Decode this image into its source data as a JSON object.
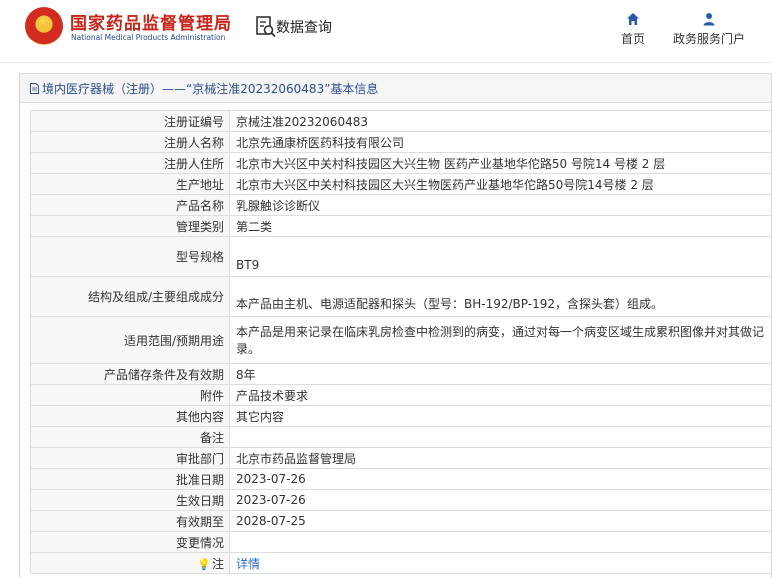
{
  "header": {
    "title_cn": "国家药品监督管理局",
    "title_en": "National Medical Products Administration",
    "search_label": "数据查询",
    "nav": [
      {
        "label": "首页",
        "icon": "home-icon"
      },
      {
        "label": "政务服务门户",
        "icon": "user-icon"
      }
    ]
  },
  "panel": {
    "title": "境内医疗器械（注册）——“京械注准20232060483”基本信息"
  },
  "rows": [
    {
      "label": "注册证编号",
      "value": "京械注准20232060483"
    },
    {
      "label": "注册人名称",
      "value": "北京先通康桥医药科技有限公司"
    },
    {
      "label": "注册人住所",
      "value": "北京市大兴区中关村科技园区大兴生物 医药产业基地华佗路50 号院14 号楼 2 层"
    },
    {
      "label": "生产地址",
      "value": "北京市大兴区中关村科技园区大兴生物医药产业基地华佗路50号院14号楼 2 层"
    },
    {
      "label": "产品名称",
      "value": "乳腺触诊诊断仪"
    },
    {
      "label": "管理类别",
      "value": "第二类"
    },
    {
      "label": "型号规格",
      "value": "BT9"
    },
    {
      "label": "结构及组成/主要组成成分",
      "value": "本产品由主机、电源适配器和探头（型号：BH-192/BP-192，含探头套）组成。"
    },
    {
      "label": "适用范围/预期用途",
      "value": "本产品是用来记录在临床乳房检查中检测到的病变，通过对每一个病变区域生成累积图像并对其做记录。"
    },
    {
      "label": "产品储存条件及有效期",
      "value": "8年"
    },
    {
      "label": "附件",
      "value": "产品技术要求"
    },
    {
      "label": "其他内容",
      "value": "其它内容"
    },
    {
      "label": "备注",
      "value": ""
    },
    {
      "label": "审批部门",
      "value": "北京市药品监督管理局"
    },
    {
      "label": "批准日期",
      "value": "2023-07-26"
    },
    {
      "label": "生效日期",
      "value": "2023-07-26"
    },
    {
      "label": "有效期至",
      "value": "2028-07-25"
    },
    {
      "label": "变更情况",
      "value": ""
    },
    {
      "label": "注",
      "value": "详情"
    }
  ]
}
